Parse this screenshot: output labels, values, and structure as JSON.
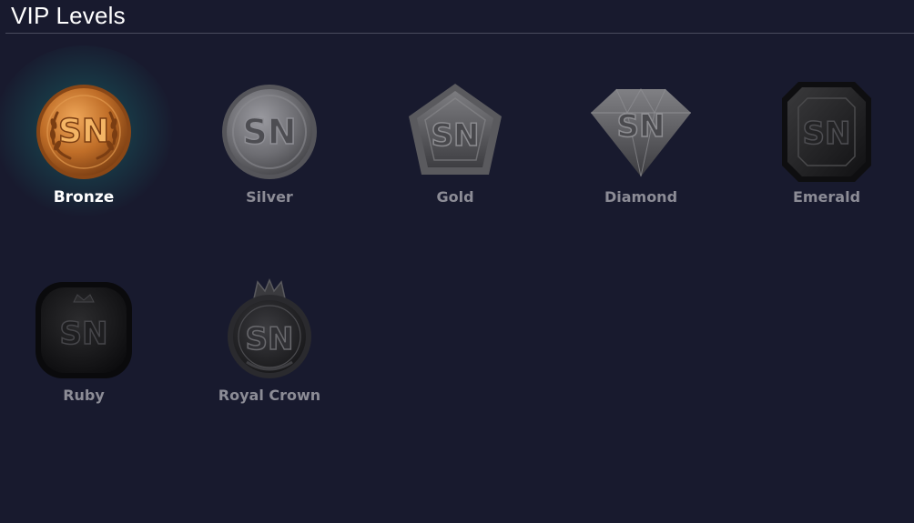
{
  "page": {
    "title": "VIP Levels"
  },
  "levels": [
    {
      "label": "Bronze",
      "emblem": "SN",
      "icon": "bronze-coin-icon",
      "shape": "coin-laurel",
      "active": true,
      "color": "#c77a35"
    },
    {
      "label": "Silver",
      "emblem": "SN",
      "icon": "silver-coin-icon",
      "shape": "coin",
      "active": false,
      "color": "#7a7a7e"
    },
    {
      "label": "Gold",
      "emblem": "SN",
      "icon": "gold-pentagon-icon",
      "shape": "pentagon",
      "active": false,
      "color": "#6a6a6e"
    },
    {
      "label": "Diamond",
      "emblem": "SN",
      "icon": "diamond-icon",
      "shape": "diamond",
      "active": false,
      "color": "#5e5e62"
    },
    {
      "label": "Emerald",
      "emblem": "SN",
      "icon": "emerald-gem-icon",
      "shape": "octagon",
      "active": false,
      "color": "#2a2a2c"
    },
    {
      "label": "Ruby",
      "emblem": "SN",
      "icon": "ruby-gem-icon",
      "shape": "cushion",
      "active": false,
      "color": "#1c1c1e"
    },
    {
      "label": "Royal Crown",
      "emblem": "SN",
      "icon": "royal-crown-icon",
      "shape": "crown-coin",
      "active": false,
      "color": "#2e2e30"
    }
  ]
}
